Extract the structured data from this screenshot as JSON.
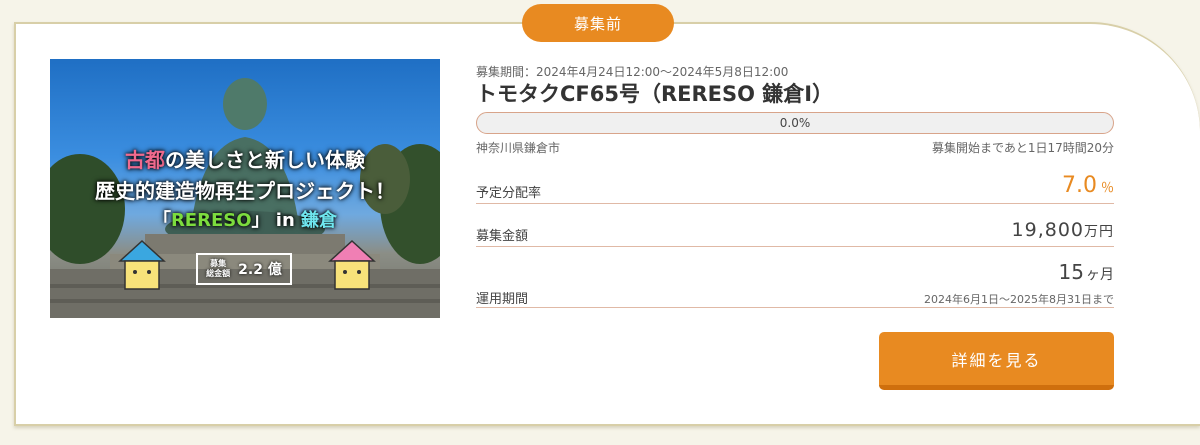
{
  "status_tab": "募集前",
  "hero": {
    "line1_highlight": "古都",
    "line1_rest": "の美しさと新しい体験",
    "line2": "歴史的建造物再生プロジェクト！",
    "line3_open": "「",
    "line3_brand": "RERESO",
    "line3_close": "」",
    "line3_in": " in ",
    "line3_place": "鎌倉",
    "box_small": "募集\n総金額",
    "box_big": "2.2 億"
  },
  "fund": {
    "period": "募集期間：2024年4月24日12:00～2024年5月8日12:00",
    "title": "トモタクCF65号（RERESO 鎌倉Ⅰ）",
    "progress_label": "0.0%",
    "progress_fraction": 0.0,
    "location": "神奈川県鎌倉市",
    "countdown": "募集開始まであと1日17時間20分"
  },
  "rate": {
    "label": "予定分配率",
    "value": "7.0",
    "unit": "％"
  },
  "amount": {
    "label": "募集金額",
    "value": "19,800",
    "unit": "万円"
  },
  "term": {
    "label": "運用期間",
    "value": "15",
    "unit": "ヶ月",
    "sub": "2024年6月1日～2025年8月31日まで"
  },
  "detail_button": "詳細を見る",
  "colors": {
    "accent": "#e88a21",
    "border": "#d8cfa8"
  }
}
